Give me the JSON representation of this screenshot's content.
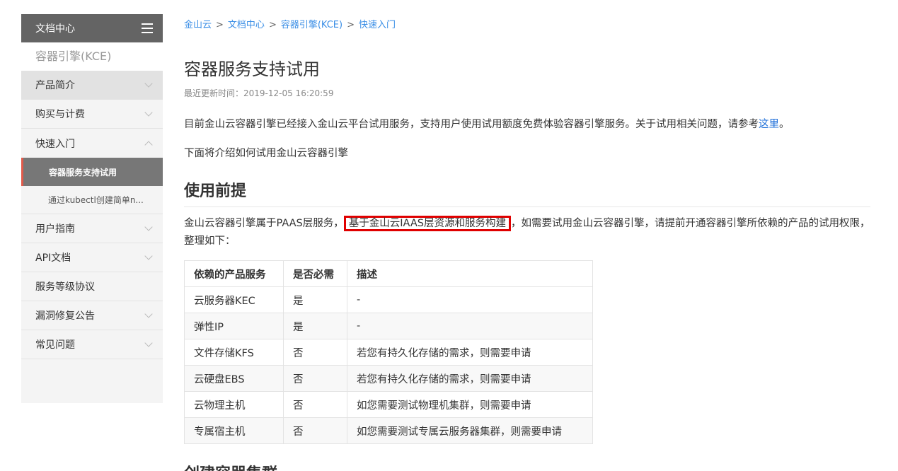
{
  "sidebar": {
    "header_title": "文档中心",
    "product": "容器引擎(KCE)",
    "items": [
      {
        "label": "产品简介"
      },
      {
        "label": "购买与计费"
      },
      {
        "label": "快速入门"
      },
      {
        "label": "用户指南"
      },
      {
        "label": "API文档"
      },
      {
        "label": "服务等级协议"
      },
      {
        "label": "漏洞修复公告"
      },
      {
        "label": "常见问题"
      }
    ],
    "sub_items": [
      {
        "label": "容器服务支持试用"
      },
      {
        "label": "通过kubectl创建简单n..."
      }
    ]
  },
  "breadcrumb": {
    "items": [
      "金山云",
      "文档中心",
      "容器引擎(KCE)",
      "快速入门"
    ],
    "sep": ">"
  },
  "page": {
    "title": "容器服务支持试用",
    "updated": "最近更新时间：2019-12-05 16:20:59",
    "intro_text": "目前金山云容器引擎已经接入金山云平台试用服务，支持用户使用试用额度免费体验容器引擎服务。关于试用相关问题，请参考",
    "intro_link": "这里",
    "intro_end": "。",
    "intro2": "下面将介绍如何试用金山云容器引擎",
    "section1_title": "使用前提",
    "section1_pre": "金山云容器引擎属于PAAS层服务，",
    "section1_highlight": "基于金山云IAAS层资源和服务构建",
    "section1_post": "，如需要试用金山云容器引擎，请提前开通容器引擎所依赖的产品的试用权限，整理如下：",
    "section2_title": "创建容器集群"
  },
  "table": {
    "headers": [
      "依赖的产品服务",
      "是否必需",
      "描述"
    ],
    "rows": [
      [
        "云服务器KEC",
        "是",
        "-"
      ],
      [
        "弹性IP",
        "是",
        "-"
      ],
      [
        "文件存储KFS",
        "否",
        "若您有持久化存储的需求，则需要申请"
      ],
      [
        "云硬盘EBS",
        "否",
        "若您有持久化存储的需求，则需要申请"
      ],
      [
        "云物理主机",
        "否",
        "如您需要测试物理机集群，则需要申请"
      ],
      [
        "专属宿主机",
        "否",
        "如您需要测试专属云服务器集群，则需要申请"
      ]
    ]
  },
  "colors": {
    "link": "#3a8ee6",
    "highlight_border": "#e00000",
    "sidebar_header": "#646464",
    "current_marker": "#e25b4b"
  }
}
